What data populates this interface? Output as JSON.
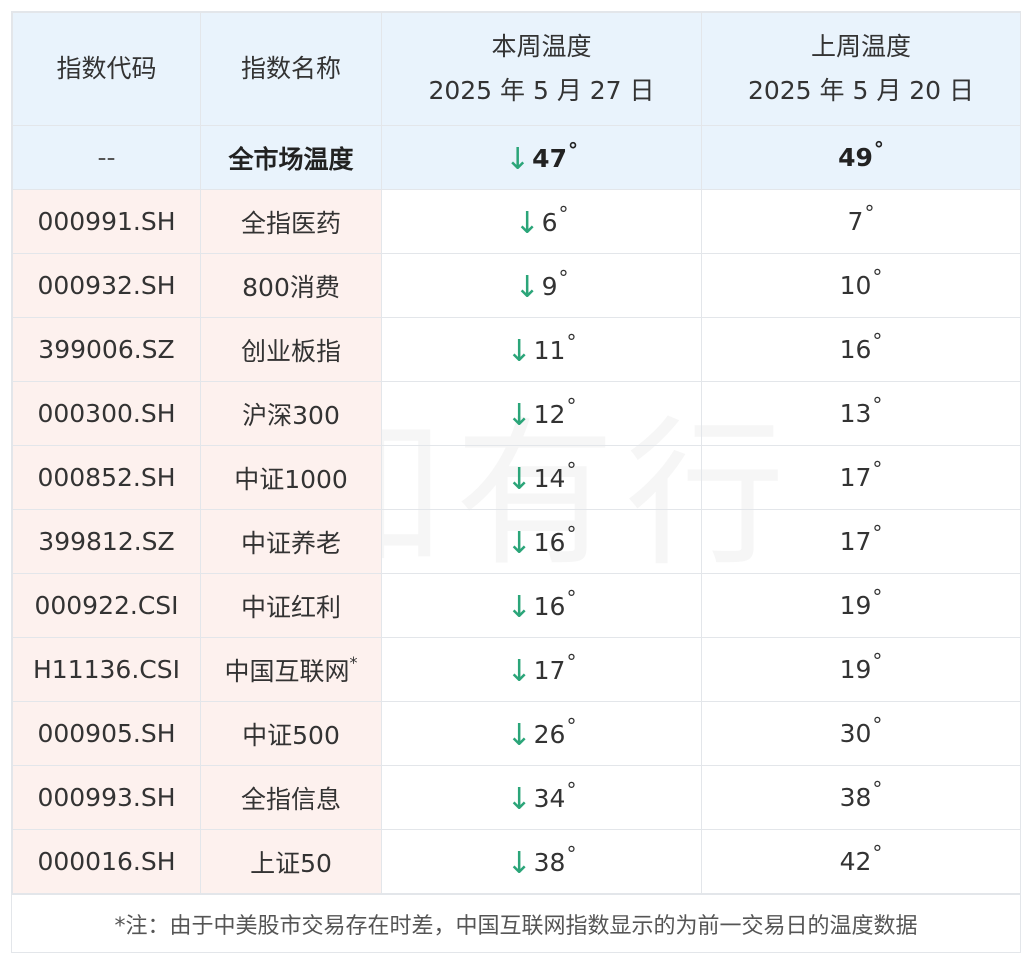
{
  "header": {
    "col_code": "指数代码",
    "col_name": "指数名称",
    "col_this_week": "本周温度",
    "this_week_date": "2025 年 5 月 27 日",
    "col_last_week": "上周温度",
    "last_week_date": "2025 年 5 月 20 日"
  },
  "summary": {
    "code": "--",
    "name": "全市场温度",
    "this_week": "47",
    "last_week": "49"
  },
  "rows": [
    {
      "code": "000991.SH",
      "name": "全指医药",
      "this_week": "6",
      "last_week": "7"
    },
    {
      "code": "000932.SH",
      "name": "800消费",
      "this_week": "9",
      "last_week": "10"
    },
    {
      "code": "399006.SZ",
      "name": "创业板指",
      "this_week": "11",
      "last_week": "16"
    },
    {
      "code": "000300.SH",
      "name": "沪深300",
      "this_week": "12",
      "last_week": "13"
    },
    {
      "code": "000852.SH",
      "name": "中证1000",
      "this_week": "14",
      "last_week": "17"
    },
    {
      "code": "399812.SZ",
      "name": "中证养老",
      "this_week": "16",
      "last_week": "17"
    },
    {
      "code": "000922.CSI",
      "name": "中证红利",
      "this_week": "16",
      "last_week": "19"
    },
    {
      "code": "H11136.CSI",
      "name": "中国互联网",
      "name_mark": "*",
      "this_week": "17",
      "last_week": "19"
    },
    {
      "code": "000905.SH",
      "name": "中证500",
      "this_week": "26",
      "last_week": "30"
    },
    {
      "code": "000993.SH",
      "name": "全指信息",
      "this_week": "34",
      "last_week": "38"
    },
    {
      "code": "000016.SH",
      "name": "上证50",
      "this_week": "38",
      "last_week": "42"
    }
  ],
  "symbols": {
    "arrow_down": "↓",
    "degree": "°"
  },
  "footnote": "*注：由于中美股市交易存在时差，中国互联网指数显示的为前一交易日的温度数据",
  "watermark": "有知有行",
  "colors": {
    "header_bg": "#e9f3fc",
    "left_cols_bg": "#fdf1ee",
    "arrow_down": "#2ba579"
  }
}
